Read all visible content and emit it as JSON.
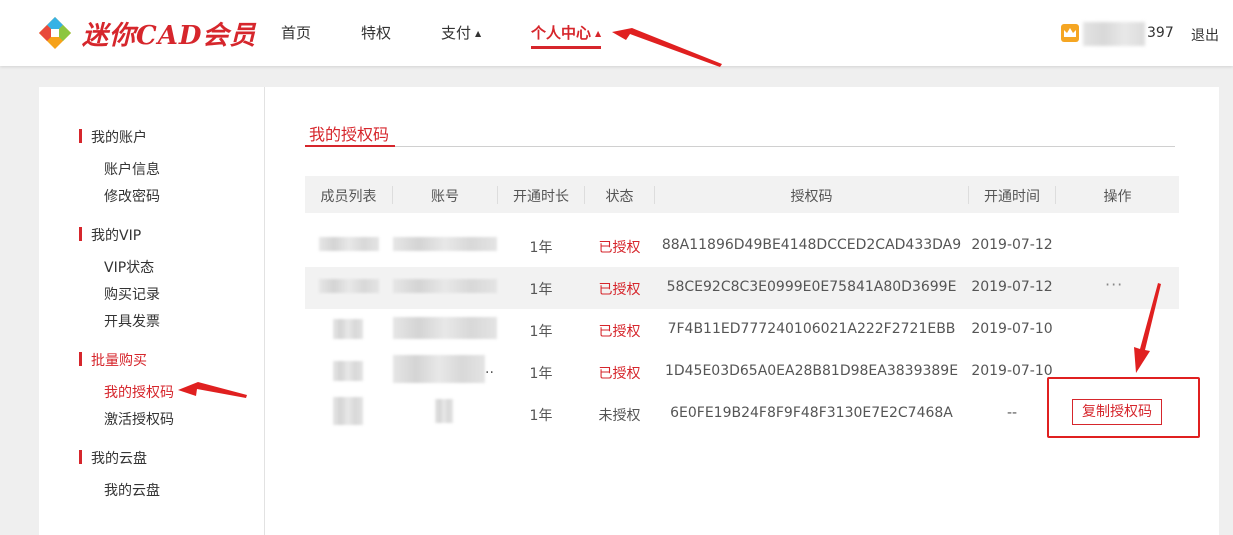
{
  "header": {
    "brand": "迷你CAD会员",
    "nav": [
      {
        "label": "首页"
      },
      {
        "label": "特权"
      },
      {
        "label": "支付",
        "caret": "▲"
      },
      {
        "label": "个人中心",
        "caret": "▲",
        "active": true
      }
    ],
    "user": {
      "name_suffix": "397",
      "logout": "退出",
      "icon": "crown-icon"
    }
  },
  "sidebar": {
    "groups": [
      {
        "title": "我的账户",
        "items": [
          "账户信息",
          "修改密码"
        ]
      },
      {
        "title": "我的VIP",
        "items": [
          "VIP状态",
          "购买记录",
          "开具发票"
        ]
      },
      {
        "title": "批量购买",
        "items": [
          "我的授权码",
          "激活授权码"
        ],
        "active_item": "我的授权码"
      },
      {
        "title": "我的云盘",
        "items": [
          "我的云盘"
        ]
      }
    ]
  },
  "main": {
    "section_title": "我的授权码",
    "table": {
      "headers": [
        "成员列表",
        "账号",
        "开通时长",
        "状态",
        "授权码",
        "开通时间",
        "操作"
      ],
      "rows": [
        {
          "duration": "1年",
          "status": "已授权",
          "code": "88A11896D49BE4148DCCED2CAD433DA9",
          "date": "2019-07-12",
          "action": ""
        },
        {
          "duration": "1年",
          "status": "已授权",
          "code": "58CE92C8C3E0999E0E75841A80D3699E",
          "date": "2019-07-12",
          "action": "···"
        },
        {
          "duration": "1年",
          "status": "已授权",
          "code": "7F4B11ED777240106021A222F2721EBB",
          "date": "2019-07-10",
          "action": ""
        },
        {
          "duration": "1年",
          "status": "已授权",
          "code": "1D45E03D65A0EA28B81D98EA3839389E",
          "date": "2019-07-10",
          "action": "",
          "account_suffix": ".."
        },
        {
          "duration": "1年",
          "status": "未授权",
          "code": "6E0FE19B24F8F9F48F3130E7E2C7468A",
          "date": "--",
          "action": "复制授权码"
        }
      ]
    }
  },
  "colors": {
    "accent": "#d6262c",
    "annotation": "#e02020"
  }
}
